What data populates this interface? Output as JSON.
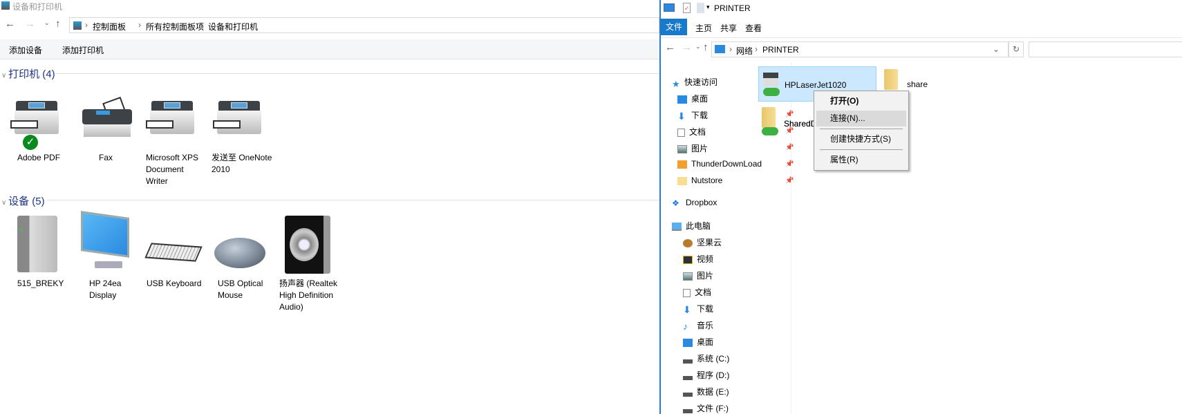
{
  "left_window": {
    "title": "设备和打印机",
    "breadcrumb": [
      "控制面板",
      "所有控制面板项",
      "设备和打印机"
    ],
    "toolbar": {
      "add_device": "添加设备",
      "add_printer": "添加打印机"
    },
    "printers_header": "打印机 (4)",
    "printers": [
      {
        "label": "Adobe PDF",
        "default": true
      },
      {
        "label": "Fax"
      },
      {
        "label": "Microsoft XPS\nDocument\nWriter"
      },
      {
        "label": "发送至 OneNote\n2010"
      }
    ],
    "devices_header": "设备 (5)",
    "devices": [
      {
        "label": "515_BREKY",
        "icon": "computer-tower-icon"
      },
      {
        "label": "HP 24ea\nDisplay",
        "icon": "monitor-icon"
      },
      {
        "label": "USB Keyboard",
        "icon": "keyboard-icon"
      },
      {
        "label": "USB Optical\nMouse",
        "icon": "mouse-icon"
      },
      {
        "label": "扬声器 (Realtek\nHigh Definition\nAudio)",
        "icon": "speaker-icon"
      }
    ]
  },
  "right_window": {
    "title": "PRINTER",
    "tabs": [
      "文件",
      "主页",
      "共享",
      "查看"
    ],
    "breadcrumb": [
      "网络",
      "PRINTER"
    ],
    "sidebar": {
      "quick_access": "快速访问",
      "quick_items": [
        "桌面",
        "下载",
        "文档",
        "图片",
        "ThunderDownLoad",
        "Nutstore"
      ],
      "dropbox": "Dropbox",
      "this_pc": "此电脑",
      "pc_items": [
        "坚果云",
        "视频",
        "图片",
        "文档",
        "下载",
        "音乐",
        "桌面",
        "系统 (C:)",
        "程序 (D:)",
        "数据 (E:)",
        "文件 (F:)"
      ]
    },
    "items": [
      "HPLaserJet1020",
      "share",
      "SharedDocs"
    ],
    "shared_docs_visible": "SharedDoc",
    "context_menu": [
      "打开(O)",
      "连接(N)...",
      "创建快捷方式(S)",
      "属性(R)"
    ]
  },
  "colors": {
    "accent": "#2b79d0",
    "selection": "#cce8ff",
    "section_header": "#1e3287"
  }
}
